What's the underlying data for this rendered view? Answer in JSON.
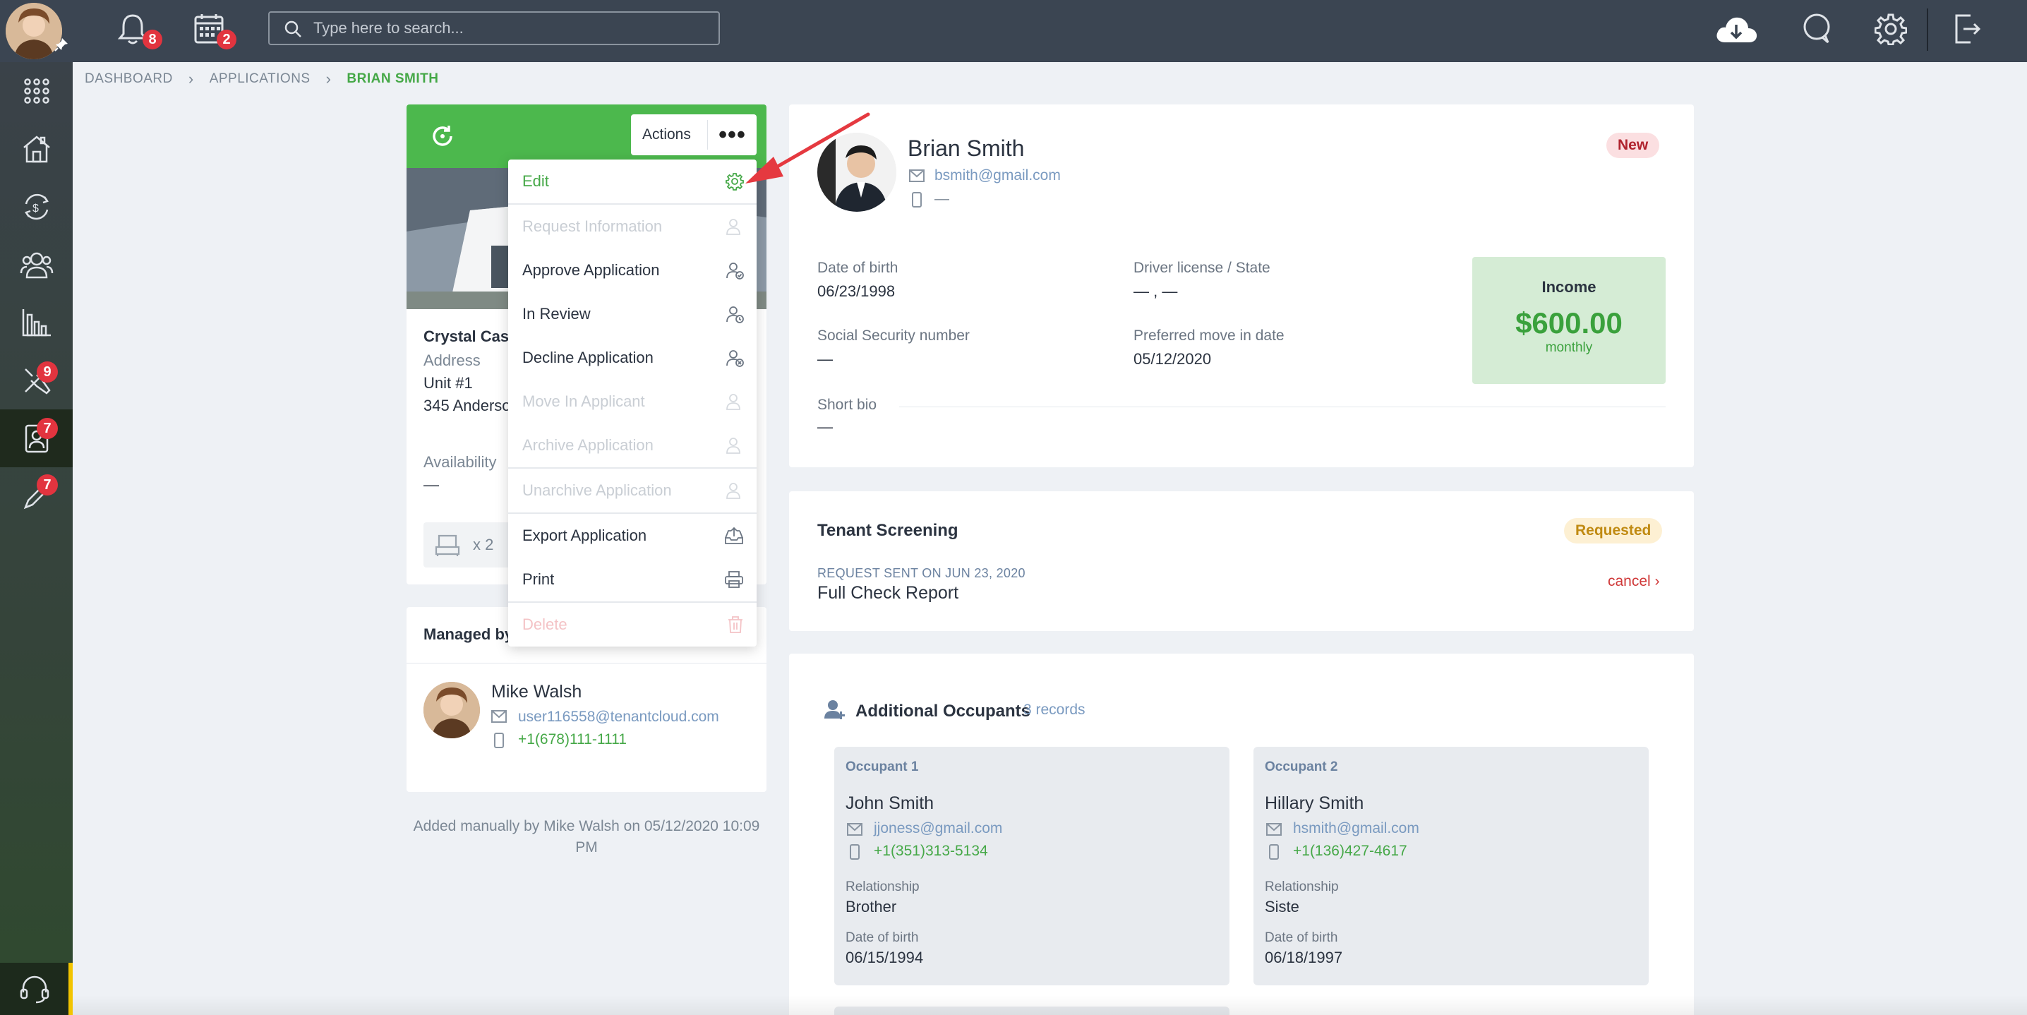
{
  "topbar": {
    "notifications_count": "8",
    "calendar_count": "2",
    "search_placeholder": "Type here to search..."
  },
  "sidebar": {
    "items": [
      {
        "icon": "apps-grid-icon",
        "badge": ""
      },
      {
        "icon": "house-icon",
        "badge": ""
      },
      {
        "icon": "money-cycle-icon",
        "badge": ""
      },
      {
        "icon": "users-icon",
        "badge": ""
      },
      {
        "icon": "reports-chart-icon",
        "badge": ""
      },
      {
        "icon": "tools-icon",
        "badge": "9"
      },
      {
        "icon": "applications-icon",
        "badge": "7"
      },
      {
        "icon": "pencil-icon",
        "badge": "7"
      }
    ]
  },
  "breadcrumb": [
    "DASHBOARD",
    "APPLICATIONS",
    "BRIAN SMITH"
  ],
  "property": {
    "actions_label": "Actions",
    "name": "Crystal Cast",
    "address_label": "Address",
    "unit": "Unit #1",
    "street": "345 Anderso",
    "availability_label": "Availability",
    "availability_value": "—",
    "beds": "x 2"
  },
  "actions_menu": [
    {
      "label": "Edit",
      "state": "edit",
      "icon": "gear-icon"
    },
    {
      "label": "Request Information",
      "state": "disabled",
      "icon": "user-icon"
    },
    {
      "label": "Approve Application",
      "state": "enabled",
      "icon": "user-check-icon"
    },
    {
      "label": "In Review",
      "state": "enabled",
      "icon": "user-icon"
    },
    {
      "label": "Decline Application",
      "state": "enabled",
      "icon": "user-x-icon"
    },
    {
      "label": "Move In Applicant",
      "state": "disabled",
      "icon": "user-icon"
    },
    {
      "label": "Archive Application",
      "state": "disabled",
      "icon": "user-icon"
    },
    {
      "label": "Unarchive Application",
      "state": "disabled",
      "icon": "user-icon"
    },
    {
      "label": "Export Application",
      "state": "enabled",
      "icon": "export-tray-icon"
    },
    {
      "label": "Print",
      "state": "enabled",
      "icon": "printer-icon"
    },
    {
      "label": "Delete",
      "state": "danger",
      "icon": "trash-icon"
    }
  ],
  "managed": {
    "header": "Managed by",
    "name": "Mike Walsh",
    "email": "user116558@tenantcloud.com",
    "phone": "+1(678)111-1111",
    "added_note": "Added manually by Mike Walsh on 05/12/2020 10:09 PM"
  },
  "applicant": {
    "name": "Brian Smith",
    "email": "bsmith@gmail.com",
    "phone": "—",
    "status": "New",
    "dob_label": "Date of birth",
    "dob": "06/23/1998",
    "license_label": "Driver license / State",
    "license": "— , —",
    "ssn_label": "Social Security number",
    "ssn": "—",
    "move_in_label": "Preferred move in date",
    "move_in": "05/12/2020",
    "bio_label": "Short bio",
    "bio": "—",
    "income_label": "Income",
    "income_value": "$600.00",
    "income_period": "monthly"
  },
  "screening": {
    "title": "Tenant Screening",
    "status": "Requested",
    "sent_label": "REQUEST SENT ON JUN 23, 2020",
    "report": "Full Check Report",
    "cancel": "cancel ›"
  },
  "occupants": {
    "title": "Additional Occupants",
    "count": "3 records",
    "items": [
      {
        "title": "Occupant 1",
        "name": "John Smith",
        "email": "jjoness@gmail.com",
        "phone": "+1(351)313-5134",
        "relationship_label": "Relationship",
        "relationship": "Brother",
        "dob_label": "Date of birth",
        "dob": "06/15/1994"
      },
      {
        "title": "Occupant 2",
        "name": "Hillary Smith",
        "email": "hsmith@gmail.com",
        "phone": "+1(136)427-4617",
        "relationship_label": "Relationship",
        "relationship": "Siste",
        "dob_label": "Date of birth",
        "dob": "06/18/1997"
      }
    ]
  },
  "colors": {
    "accent_green": "#4cb84d",
    "topbar": "#3b4552",
    "badge_red": "#e2343f",
    "arrow_red": "#e53940"
  }
}
